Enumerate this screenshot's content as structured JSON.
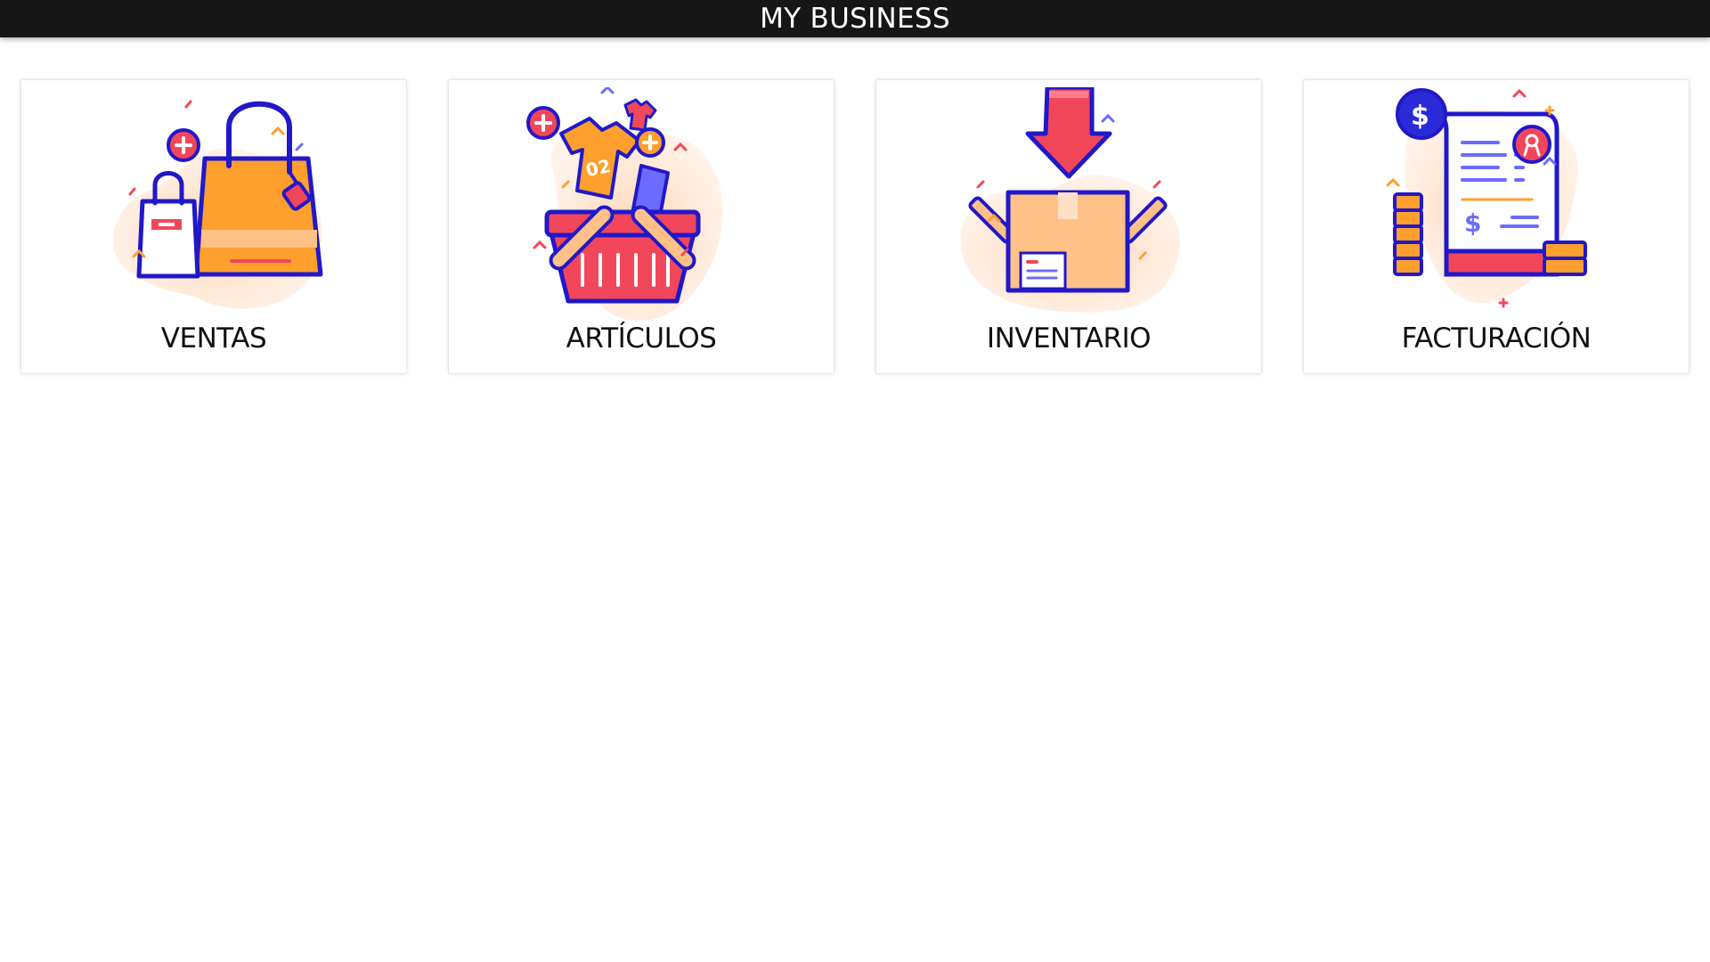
{
  "header": {
    "title": "MY BUSINESS"
  },
  "cards": [
    {
      "label": "VENTAS",
      "icon": "shopping-bags-icon"
    },
    {
      "label": "ARTÍCULOS",
      "icon": "shopping-basket-icon"
    },
    {
      "label": "INVENTARIO",
      "icon": "inventory-box-icon"
    },
    {
      "label": "FACTURACIÓN",
      "icon": "invoice-receipt-icon"
    }
  ],
  "colors": {
    "header_bg": "#161616",
    "outline": "#2118c9",
    "orange": "#ff9f2e",
    "red": "#f2475a",
    "blob": "#ffe2cc"
  }
}
